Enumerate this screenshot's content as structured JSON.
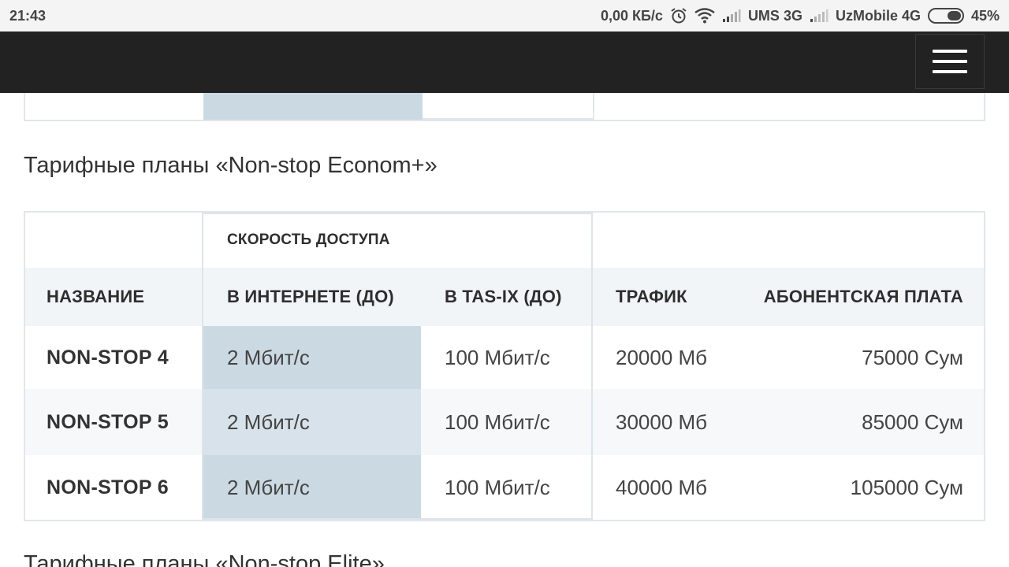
{
  "status_bar": {
    "time": "21:43",
    "net_speed": "0,00 КБ/с",
    "carrier1": "UMS 3G",
    "carrier2": "UzMobile 4G",
    "battery_text": "45%",
    "battery_level": 0.45
  },
  "sections": [
    {
      "title": "Тарифные планы «Non-stop Econom+»"
    },
    {
      "title": "Тарифные планы «Non-stop Elite»"
    }
  ],
  "tariff_table": {
    "group_header": "СКОРОСТЬ ДОСТУПА",
    "columns": [
      "НАЗВАНИЕ",
      "В ИНТЕРНЕТЕ (ДО)",
      "В TAS-IX (ДО)",
      "ТРАФИК",
      "АБОНЕНТСКАЯ ПЛАТА"
    ],
    "rows": [
      {
        "name": "NON-STOP 4",
        "internet": "2 Мбит/с",
        "tasix": "100 Мбит/с",
        "traffic": "20000 Мб",
        "fee": "75000 Сум"
      },
      {
        "name": "NON-STOP 5",
        "internet": "2 Мбит/с",
        "tasix": "100 Мбит/с",
        "traffic": "30000 Мб",
        "fee": "85000 Сум"
      },
      {
        "name": "NON-STOP 6",
        "internet": "2 Мбит/с",
        "tasix": "100 Мбит/с",
        "traffic": "40000 Мб",
        "fee": "105000 Сум"
      }
    ]
  },
  "colors": {
    "header_bg": "#222222",
    "header_row_bg": "#f1f5f8",
    "alt_row_bg": "#f6f8fa",
    "highlight_col_bg": "#cbd9e3",
    "highlight_col_alt_bg": "#d7e2ea",
    "border": "#e3e6e9"
  },
  "icons": [
    "alarm-icon",
    "wifi-icon",
    "signal-icon",
    "battery-icon",
    "menu-icon"
  ]
}
